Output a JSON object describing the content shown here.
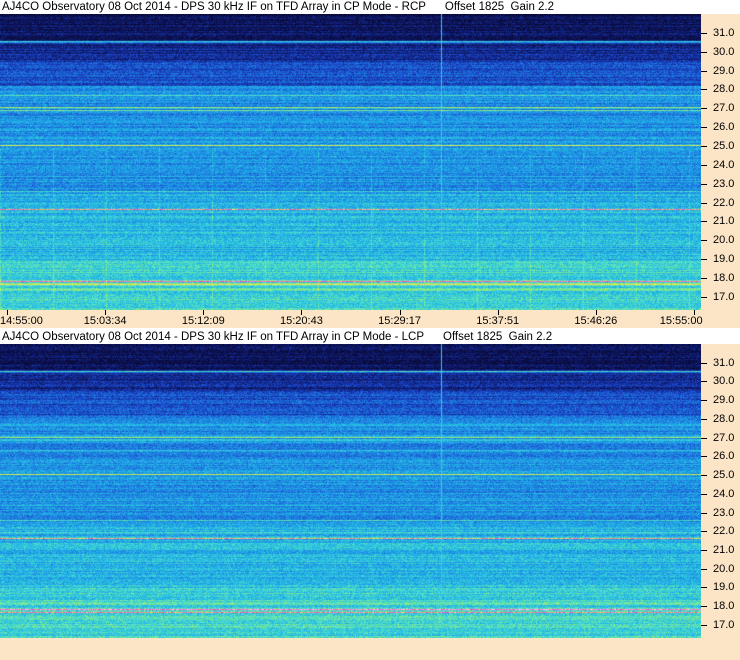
{
  "chart_data": [
    {
      "type": "heatmap",
      "title": "AJ4CO Observatory 08 Oct 2014 - DPS 30 kHz IF on TFD Array in CP Mode - RCP      Offset 1825  Gain 2.2",
      "x_tick_labels": [
        "14:55:00",
        "15:03:34",
        "15:12:09",
        "15:20:43",
        "15:29:17",
        "15:37:51",
        "15:46:26",
        "15:55:00"
      ],
      "xlim": [
        "14:55:00",
        "15:55:00"
      ],
      "y_ticks": [
        31.0,
        30.0,
        29.0,
        28.0,
        27.0,
        26.0,
        25.0,
        24.0,
        23.0,
        22.0,
        21.0,
        20.0,
        19.0,
        18.0,
        17.0
      ],
      "y_tick_labels": [
        "31.0",
        "30.0",
        "29.0",
        "28.0",
        "27.0",
        "26.0",
        "25.0",
        "24.0",
        "23.0",
        "22.0",
        "21.0",
        "20.0",
        "19.0",
        "18.0",
        "17.0"
      ],
      "ylim": [
        16.3,
        32.0
      ],
      "ylabel": "",
      "xlabel": ""
    },
    {
      "type": "heatmap",
      "title": "AJ4CO Observatory 08 Oct 2014 - DPS 30 kHz IF on TFD Array in CP Mode - LCP      Offset 1825  Gain 2.2",
      "x_tick_labels": [],
      "xlim": [
        "14:55:00",
        "15:55:00"
      ],
      "y_ticks": [
        31.0,
        30.0,
        29.0,
        28.0,
        27.0,
        26.0,
        25.0,
        24.0,
        23.0,
        22.0,
        21.0,
        20.0,
        19.0,
        18.0,
        17.0
      ],
      "y_tick_labels": [
        "31.0",
        "30.0",
        "29.0",
        "28.0",
        "27.0",
        "26.0",
        "25.0",
        "24.0",
        "23.0",
        "22.0",
        "21.0",
        "20.0",
        "19.0",
        "18.0",
        "17.0"
      ],
      "ylim": [
        16.3,
        32.0
      ],
      "ylabel": "",
      "xlabel": ""
    }
  ],
  "colors": {
    "axis_background": "#fbe5c6",
    "colormap": [
      "#0a0a3a",
      "#10207a",
      "#1a44c8",
      "#1e7fe0",
      "#20b4e8",
      "#4ee0c8",
      "#b0f05a",
      "#f0f04a",
      "#ff3cc8",
      "#ffffff"
    ]
  }
}
